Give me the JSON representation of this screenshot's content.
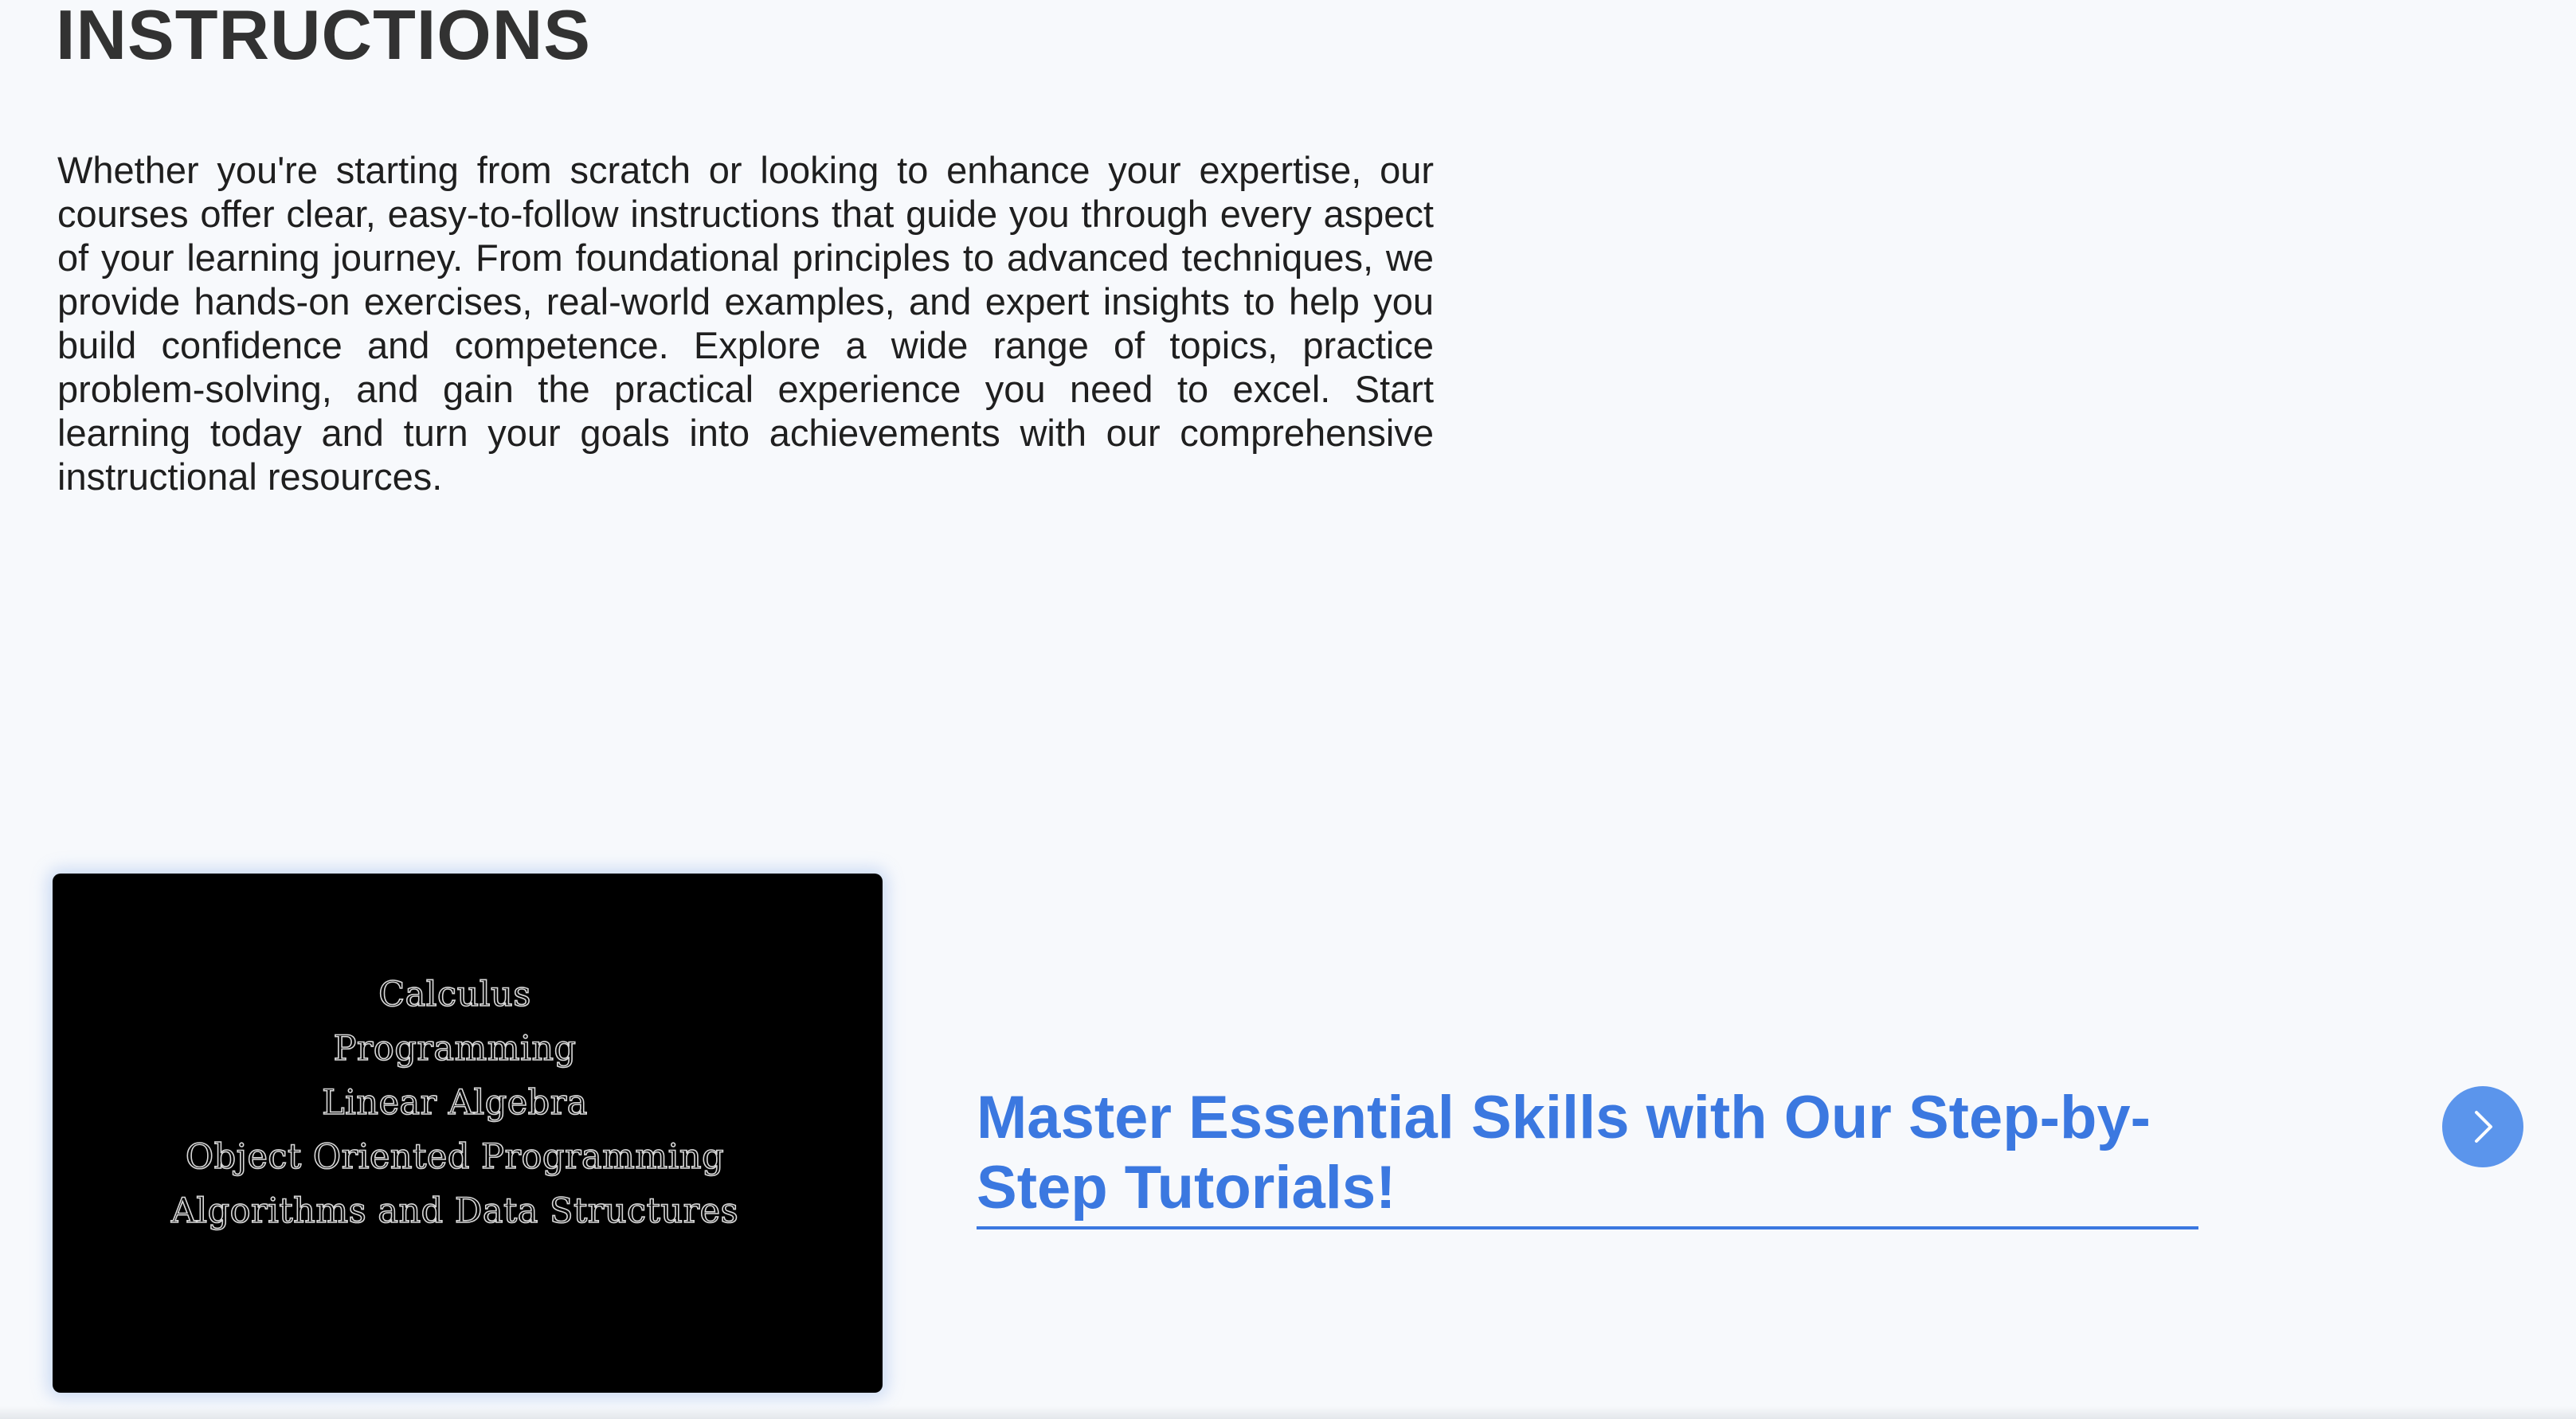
{
  "header": {
    "title": "INSTRUCTIONS"
  },
  "intro": {
    "paragraph": "Whether you're starting from scratch or looking to enhance your expertise, our courses offer clear, easy-to-follow instructions that guide you through every aspect of your learning journey. From foundational principles to advanced techniques, we provide hands-on exercises, real-world examples, and expert insights to help you build confidence and competence. Explore a wide range of topics, practice problem-solving, and gain the practical experience you need to excel. Start learning today and turn your goals into achievements with our comprehensive instructional resources."
  },
  "video": {
    "topics": [
      "Calculus",
      "Programming",
      "Linear Algebra",
      "Object Oriented Programming",
      "Algorithms and Data Structures"
    ]
  },
  "promo": {
    "headline": "Master Essential Skills with Our Step-by-Step Tutorials!"
  },
  "controls": {
    "next_icon": "chevron-right-icon"
  },
  "colors": {
    "accent": "#3b78e0",
    "button": "#5b95ec",
    "background": "#f7f9fc",
    "text": "#1f1f1f"
  }
}
